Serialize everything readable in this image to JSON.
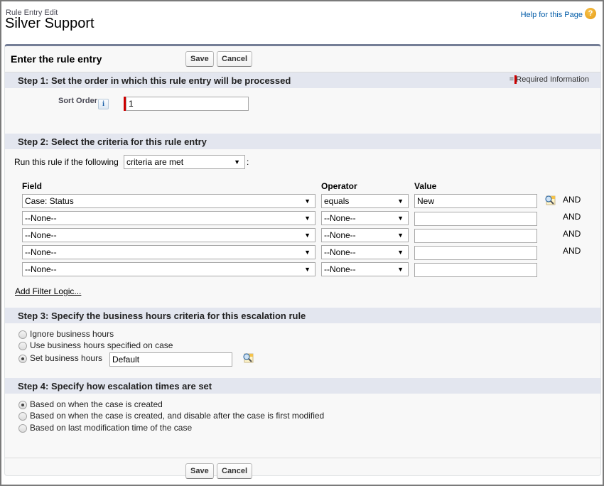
{
  "header": {
    "page_type": "Rule Entry Edit",
    "title": "Silver Support",
    "help_link": "Help for this Page",
    "help_icon": "question-circle-icon"
  },
  "panel": {
    "title": "Enter the rule entry",
    "save_label": "Save",
    "cancel_label": "Cancel",
    "required_info": "= Required Information"
  },
  "step1": {
    "title": "Step 1: Set the order in which this rule entry will be processed",
    "sort_order_label": "Sort Order",
    "info_icon": "i",
    "sort_order_value": "1"
  },
  "step2": {
    "title": "Step 2: Select the criteria for this rule entry",
    "run_rule_label": "Run this rule if the following",
    "criteria_selected": "criteria are met",
    "colon": ":",
    "columns": {
      "field": "Field",
      "operator": "Operator",
      "value": "Value"
    },
    "rows": [
      {
        "field": "Case: Status",
        "operator": "equals",
        "value": "New",
        "connector": "AND"
      },
      {
        "field": "--None--",
        "operator": "--None--",
        "value": "",
        "connector": "AND"
      },
      {
        "field": "--None--",
        "operator": "--None--",
        "value": "",
        "connector": "AND"
      },
      {
        "field": "--None--",
        "operator": "--None--",
        "value": "",
        "connector": "AND"
      },
      {
        "field": "--None--",
        "operator": "--None--",
        "value": "",
        "connector": ""
      }
    ],
    "add_filter_logic": "Add Filter Logic..."
  },
  "step3": {
    "title": "Step 3: Specify the business hours criteria for this escalation rule",
    "options": [
      {
        "label": "Ignore business hours",
        "checked": false
      },
      {
        "label": "Use business hours specified on case",
        "checked": false
      },
      {
        "label": "Set business hours",
        "checked": true
      }
    ],
    "business_hours_value": "Default"
  },
  "step4": {
    "title": "Step 4: Specify how escalation times are set",
    "options": [
      {
        "label": "Based on when the case is created",
        "checked": true
      },
      {
        "label": "Based on when the case is created, and disable after the case is first modified",
        "checked": false
      },
      {
        "label": "Based on last modification time of the case",
        "checked": false
      }
    ]
  },
  "footer": {
    "save_label": "Save",
    "cancel_label": "Cancel"
  },
  "colors": {
    "accent_bar": "#747e96",
    "step_bar": "#e3e6ef",
    "required": "#cc0000",
    "link": "#015ba7"
  }
}
